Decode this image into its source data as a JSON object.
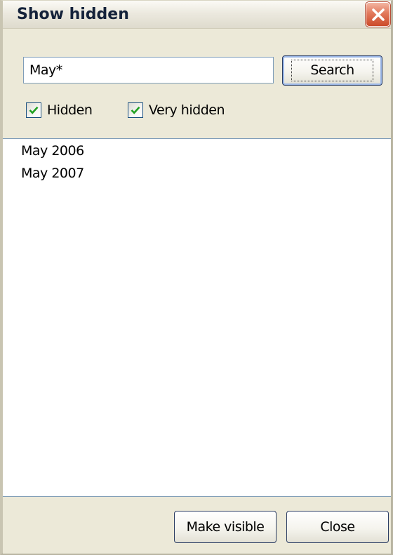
{
  "window": {
    "title": "Show hidden"
  },
  "search": {
    "value": "May*",
    "button_label": "Search"
  },
  "filters": {
    "hidden_label": "Hidden",
    "hidden_checked": true,
    "very_hidden_label": "Very hidden",
    "very_hidden_checked": true
  },
  "results": {
    "items": [
      {
        "label": "May 2006"
      },
      {
        "label": "May 2007"
      }
    ]
  },
  "footer": {
    "make_visible_label": "Make visible",
    "close_label": "Close"
  },
  "icons": {
    "window_close": "close-icon",
    "checkbox_mark": "checkmark-icon"
  },
  "colors": {
    "window_bg": "#ece9d8",
    "close_button": "#d9623f",
    "input_border": "#7f9db9",
    "checkbox_border": "#1c5180"
  }
}
